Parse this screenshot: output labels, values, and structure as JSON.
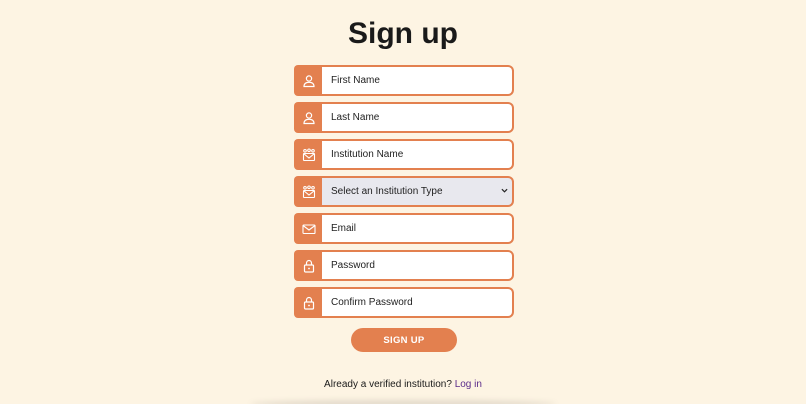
{
  "page": {
    "title": "Sign up"
  },
  "form": {
    "first_name": {
      "placeholder": "First Name",
      "icon": "user-icon"
    },
    "last_name": {
      "placeholder": "Last Name",
      "icon": "user-icon"
    },
    "institution_name": {
      "placeholder": "Institution Name",
      "icon": "institution-icon"
    },
    "institution_type": {
      "selected": "Select an Institution Type",
      "icon": "institution-icon"
    },
    "email": {
      "placeholder": "Email",
      "icon": "envelope-icon"
    },
    "password": {
      "placeholder": "Password",
      "icon": "lock-icon"
    },
    "confirm_password": {
      "placeholder": "Confirm Password",
      "icon": "lock-icon"
    },
    "submit_label": "SIGN UP"
  },
  "footer": {
    "prompt": "Already a verified institution?",
    "login_link": "Log in"
  },
  "colors": {
    "background": "#fdf4e3",
    "accent": "#e3804f",
    "link": "#5b2c8a"
  }
}
